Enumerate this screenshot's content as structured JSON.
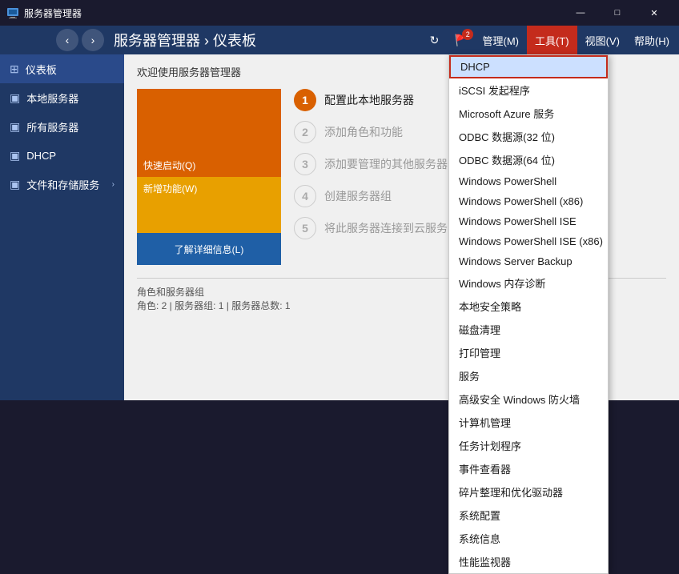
{
  "titleBar": {
    "icon": "server-manager-icon",
    "title": "服务器管理器",
    "controls": {
      "minimize": "—",
      "maximize": "□",
      "close": "✕"
    }
  },
  "menuBar": {
    "navBack": "‹",
    "navForward": "›",
    "refresh": "↻",
    "notifyCount": "2",
    "title": "服务器管理器 › 仪表板",
    "menus": [
      {
        "id": "manage",
        "label": "管理(M)"
      },
      {
        "id": "tools",
        "label": "工具(T)",
        "active": true
      },
      {
        "id": "view",
        "label": "视图(V)"
      },
      {
        "id": "help",
        "label": "帮助(H)"
      }
    ]
  },
  "sidebar": {
    "items": [
      {
        "id": "dashboard",
        "label": "仪表板",
        "icon": "■",
        "active": true
      },
      {
        "id": "local",
        "label": "本地服务器",
        "icon": "□"
      },
      {
        "id": "all",
        "label": "所有服务器",
        "icon": "□"
      },
      {
        "id": "dhcp",
        "label": "DHCP",
        "icon": "□"
      },
      {
        "id": "files",
        "label": "文件和存储服务",
        "icon": "□",
        "arrow": "›"
      }
    ]
  },
  "main": {
    "welcomeTitle": "欢迎使用服务器管理器",
    "quickstart": {
      "block1Label": "快速启动(Q)",
      "block2Label": "新增功能(W)",
      "block3Label": "了解详细信息(L)"
    },
    "tasks": [
      {
        "num": "1",
        "label": "配置此本地服务器",
        "active": true
      },
      {
        "num": "2",
        "label": "添加角色和功能",
        "active": false
      },
      {
        "num": "3",
        "label": "添加要管理的其他服务器",
        "active": false
      },
      {
        "num": "4",
        "label": "创建服务器组",
        "active": false
      },
      {
        "num": "5",
        "label": "将此服务器连接到云服务",
        "active": false
      }
    ],
    "rolesSection": {
      "title": "角色和服务器组",
      "subtitle": "角色: 2 | 服务器组: 1 | 服务器总数: 1"
    }
  },
  "toolsMenu": {
    "items": [
      {
        "id": "dhcp",
        "label": "DHCP",
        "highlighted": true
      },
      {
        "id": "iscsi",
        "label": "iSCSI 发起程序"
      },
      {
        "id": "azure",
        "label": "Microsoft Azure 服务"
      },
      {
        "id": "odbc32",
        "label": "ODBC 数据源(32 位)"
      },
      {
        "id": "odbc64",
        "label": "ODBC 数据源(64 位)"
      },
      {
        "id": "powershell",
        "label": "Windows PowerShell"
      },
      {
        "id": "powershellx86",
        "label": "Windows PowerShell (x86)"
      },
      {
        "id": "powershellise",
        "label": "Windows PowerShell ISE"
      },
      {
        "id": "powershellisex86",
        "label": "Windows PowerShell ISE (x86)"
      },
      {
        "id": "wsb",
        "label": "Windows Server Backup"
      },
      {
        "id": "memdiag",
        "label": "Windows 内存诊断"
      },
      {
        "id": "secpol",
        "label": "本地安全策略"
      },
      {
        "id": "diskclean",
        "label": "磁盘清理"
      },
      {
        "id": "printmgmt",
        "label": "打印管理"
      },
      {
        "id": "services",
        "label": "服务"
      },
      {
        "id": "firewall",
        "label": "高级安全 Windows 防火墙"
      },
      {
        "id": "compmgmt",
        "label": "计算机管理"
      },
      {
        "id": "taskschd",
        "label": "任务计划程序"
      },
      {
        "id": "eventvwr",
        "label": "事件查看器"
      },
      {
        "id": "dfrag",
        "label": "碎片整理和优化驱动器"
      },
      {
        "id": "msconfig",
        "label": "系统配置"
      },
      {
        "id": "sysinfo",
        "label": "系统信息"
      },
      {
        "id": "perfmon",
        "label": "性能监视器"
      }
    ]
  }
}
